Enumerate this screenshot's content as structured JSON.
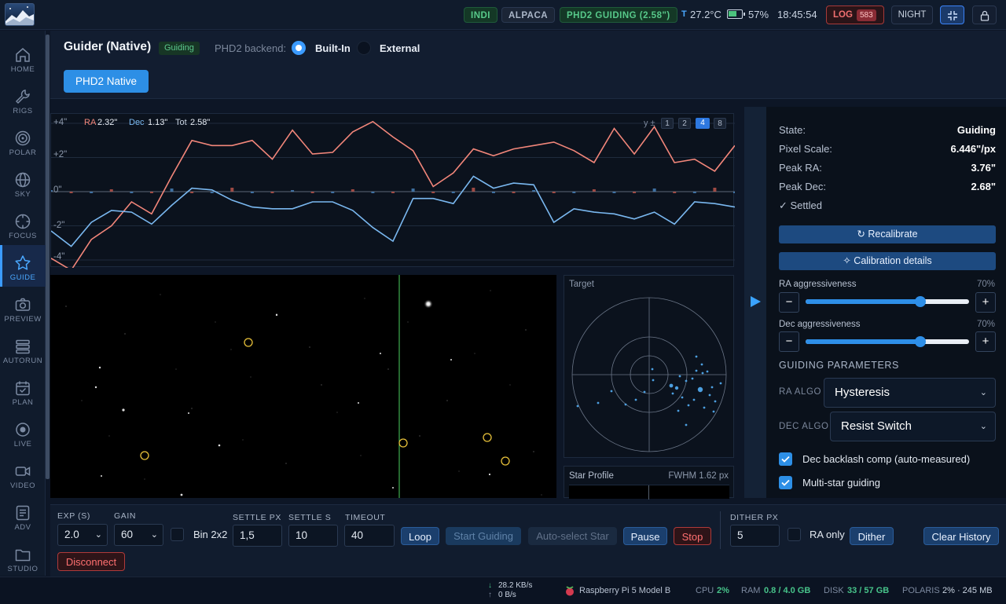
{
  "topbar": {
    "badges": {
      "indi": "INDI",
      "alpaca": "ALPACA",
      "phd2": "PHD2 GUIDING (2.58\")"
    },
    "temp_prefix": "T",
    "temp": "27.2°C",
    "battery": "57%",
    "time": "18:45:54",
    "log_label": "LOG",
    "log_count": "583",
    "night": "NIGHT"
  },
  "sidebar": {
    "items": [
      {
        "label": "HOME",
        "icon": "home-icon"
      },
      {
        "label": "RIGS",
        "icon": "wrench-icon"
      },
      {
        "label": "POLAR",
        "icon": "target-icon"
      },
      {
        "label": "SKY",
        "icon": "globe-icon"
      },
      {
        "label": "FOCUS",
        "icon": "focus-icon"
      },
      {
        "label": "GUIDE",
        "icon": "star-icon"
      },
      {
        "label": "PREVIEW",
        "icon": "camera-icon"
      },
      {
        "label": "AUTORUN",
        "icon": "stack-icon"
      },
      {
        "label": "PLAN",
        "icon": "calendar-icon"
      },
      {
        "label": "LIVE",
        "icon": "record-icon"
      },
      {
        "label": "VIDEO",
        "icon": "video-icon"
      },
      {
        "label": "ADV",
        "icon": "list-icon"
      },
      {
        "label": "STUDIO",
        "icon": "folder-icon"
      }
    ]
  },
  "header": {
    "title": "Guider (Native)",
    "status_badge": "Guiding",
    "backend_label": "PHD2 backend:",
    "option_builtin": "Built-In",
    "option_external": "External",
    "tab": "PHD2 Native"
  },
  "graph": {
    "ra_label": "RA",
    "ra_value": "2.32\"",
    "dec_label": "Dec",
    "dec_value": "1.13\"",
    "tot_label": "Tot",
    "tot_value": "2.58\"",
    "y_scale_label": "y ±",
    "scale_options": [
      "1",
      "2",
      "4",
      "8"
    ],
    "active_scale": "4",
    "y_ticks": [
      "+4\"",
      "+2\"",
      "0\"",
      "-2\"",
      "-4\""
    ]
  },
  "chart_data": {
    "type": "line",
    "ylim": [
      -4,
      4
    ],
    "series": [
      {
        "name": "RA",
        "color": "#f2867a",
        "values": [
          -3.9,
          -4.6,
          -2.8,
          -2.0,
          -0.6,
          -1.3,
          0.9,
          3.0,
          2.7,
          2.7,
          3.0,
          1.9,
          3.6,
          2.2,
          2.3,
          3.5,
          4.1,
          3.2,
          2.4,
          0.3,
          1.1,
          2.5,
          2.1,
          2.5,
          2.7,
          2.9,
          2.4,
          1.7,
          3.7,
          2.2,
          3.8,
          1.7,
          1.9,
          1.2,
          2.7
        ]
      },
      {
        "name": "Dec",
        "color": "#7ab8f0",
        "values": [
          -2.3,
          -3.2,
          -1.8,
          -1.1,
          -1.2,
          -1.9,
          -0.8,
          0.2,
          0.1,
          -0.5,
          -0.9,
          -1.0,
          -1.0,
          -0.6,
          -0.6,
          -1.1,
          -2.1,
          -2.9,
          -0.4,
          -0.4,
          -0.7,
          0.9,
          0.2,
          0.5,
          0.4,
          -1.8,
          -1.0,
          -1.2,
          -1.3,
          -1.6,
          -1.2,
          -1.9,
          -0.6,
          -0.7,
          -0.9
        ]
      }
    ]
  },
  "camera": {
    "cursor_present": true
  },
  "target_panel": {
    "title": "Target"
  },
  "profile_panel": {
    "title": "Star Profile",
    "fwhm": "FWHM 1.62 px"
  },
  "right": {
    "state_label": "State:",
    "state_value": "Guiding",
    "pixel_label": "Pixel Scale:",
    "pixel_value": "6.446\"/px",
    "peak_ra_label": "Peak RA:",
    "peak_ra_value": "3.76\"",
    "peak_dec_label": "Peak Dec:",
    "peak_dec_value": "2.68\"",
    "settled": "✓ Settled",
    "recalibrate": "Recalibrate",
    "calibration_details": "Calibration details",
    "ra_aggr_label": "RA aggressiveness",
    "ra_aggr_value": "70%",
    "ra_aggr_level": 0.7,
    "dec_aggr_label": "Dec aggressiveness",
    "dec_aggr_value": "70%",
    "dec_aggr_level": 0.7,
    "params_heading": "GUIDING PARAMETERS",
    "ra_algo_label": "RA ALGO",
    "ra_algo_value": "Hysteresis",
    "dec_algo_label": "DEC ALGO",
    "dec_algo_value": "Resist Switch",
    "backlash_label": "Dec backlash comp (auto-measured)",
    "multistar_label": "Multi-star guiding"
  },
  "bottom": {
    "exp_label": "EXP (S)",
    "exp_value": "2.0",
    "gain_label": "GAIN",
    "gain_value": "60",
    "bin_label": "Bin 2x2",
    "settle_px_label": "SETTLE PX",
    "settle_px_value": "1,5",
    "settle_s_label": "SETTLE S",
    "settle_s_value": "10",
    "timeout_label": "TIMEOUT",
    "timeout_value": "40",
    "loop": "Loop",
    "start_guiding": "Start Guiding",
    "auto_select": "Auto-select Star",
    "pause": "Pause",
    "stop": "Stop",
    "dither_px_label": "DITHER PX",
    "dither_px_value": "5",
    "ra_only_label": "RA only",
    "dither": "Dither",
    "clear_history": "Clear History",
    "disconnect": "Disconnect"
  },
  "status": {
    "down": "28.2 KB/s",
    "up": "0 B/s",
    "device": "Raspberry Pi 5 Model B",
    "cpu_label": "CPU",
    "cpu": "2%",
    "ram_label": "RAM",
    "ram": "0.8 / 4.0 GB",
    "disk_label": "DISK",
    "disk": "33 / 57 GB",
    "polaris_label": "POLARIS",
    "polaris": "2% · 245 MB"
  }
}
